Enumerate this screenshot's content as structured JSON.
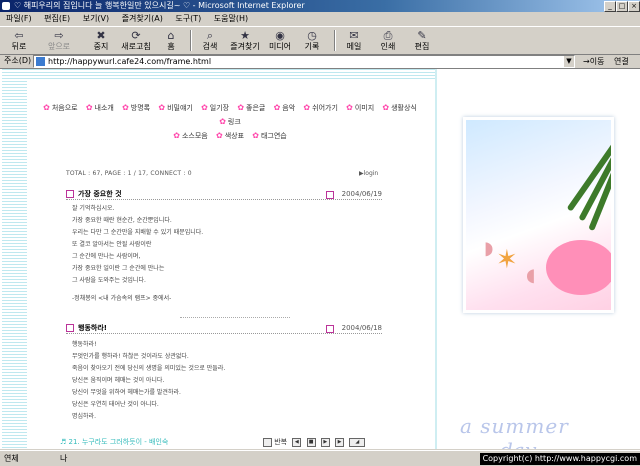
{
  "window": {
    "title": "♡ 해피우리의 집입니다 늘 행복한일만 있으시길~ ♡ - Microsoft Internet Explorer",
    "minimize": "_",
    "maximize": "□",
    "close": "×"
  },
  "menu": [
    "파일(F)",
    "편집(E)",
    "보기(V)",
    "즐겨찾기(A)",
    "도구(T)",
    "도움말(H)"
  ],
  "toolbar": {
    "back": "뒤로",
    "forward": "앞으로",
    "stop": "중지",
    "refresh": "새로고침",
    "home": "홈",
    "search": "검색",
    "favorites": "즐겨찾기",
    "media": "미디어",
    "history": "기록",
    "mail": "메일",
    "print": "인쇄",
    "edit": "편집"
  },
  "address": {
    "label": "주소(D)",
    "url": "http://happywurl.cafe24.com/frame.html",
    "go": "이동",
    "links": "연결"
  },
  "page": {
    "nav": [
      "처음으로",
      "내소개",
      "방명록",
      "비밀얘기",
      "일기장",
      "좋은글",
      "음악",
      "쉬어가기",
      "이미지",
      "생활상식",
      "링크",
      "소스모음",
      "색상표",
      "태그연습"
    ],
    "stats": "TOTAL : 67,  PAGE : 1 / 17,  CONNECT : 0",
    "login": "▶login",
    "posts": [
      {
        "title": "가장 중요한 것",
        "date": "2004/06/19",
        "lines": [
          "잘 기억하십시오.",
          "가장 중요한 때란 현순간, 순간뿐입니다.",
          "우리는 다만 그 순간만을 지배할 수 있기 때문입니다.",
          "또 결코 알아서는 안될 사람이란",
          "그 순간에 만나는 사람이며,",
          "가장 중요한 일이란 그 순간에 만나는",
          "그 사람을 도와주는 것입니다.",
          "",
          "-정채봉의 <내 가슴속의 램프> 중에서-"
        ]
      },
      {
        "title": "행동하라!",
        "date": "2004/06/18",
        "lines": [
          "행동하라!",
          "무엇인가를 행하라! 하찮은 것이라도 상관없다.",
          "죽음이 찾아오기 전에 당신의 생명을 의미있는 것으로 만들라.",
          "당신은 움직이며 헤매는 것이 아니다.",
          "당신이 무엇을 위하여 헤매는가를 발견하라.",
          "당신은 우연히 태어난 것이 아니다.",
          "명심하라."
        ]
      }
    ],
    "music": "♬ 21. 누구라도 그러하듯이 - 배인숙",
    "repeat": "반복"
  },
  "decor": {
    "line1": "a summer",
    "line2": "day",
    "flowers": "✿✿✿✿"
  },
  "status": {
    "left": "연체",
    "mid": "나",
    "copyright": "Copyright(c) http://www.happycgi.com"
  }
}
